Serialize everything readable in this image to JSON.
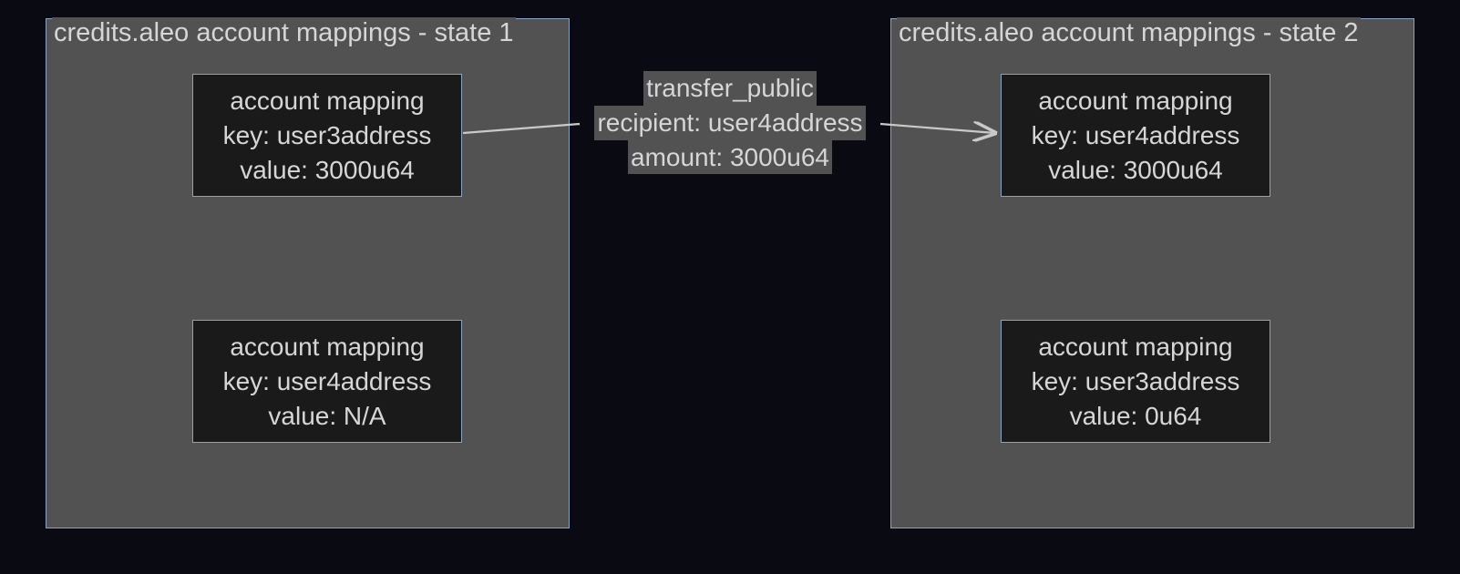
{
  "panels": {
    "state1": {
      "title": "credits.aleo account mappings - state 1",
      "boxes": {
        "top": {
          "line1": "account mapping",
          "line2": "key: user3address",
          "line3": "value: 3000u64"
        },
        "bottom": {
          "line1": "account mapping",
          "line2": "key: user4address",
          "line3": "value: N/A"
        }
      }
    },
    "state2": {
      "title": "credits.aleo account mappings - state 2",
      "boxes": {
        "top": {
          "line1": "account mapping",
          "line2": "key: user4address",
          "line3": "value: 3000u64"
        },
        "bottom": {
          "line1": "account mapping",
          "line2": "key: user3address",
          "line3": "value: 0u64"
        }
      }
    }
  },
  "edge": {
    "line1": "transfer_public",
    "line2": "recipient: user4address",
    "line3": "amount: 3000u64"
  },
  "colors": {
    "bg": "#0a0a12",
    "panel": "#525252",
    "border": "#8aa3c2",
    "boxBg": "#1a1a1a",
    "text": "#d6d6d6"
  }
}
